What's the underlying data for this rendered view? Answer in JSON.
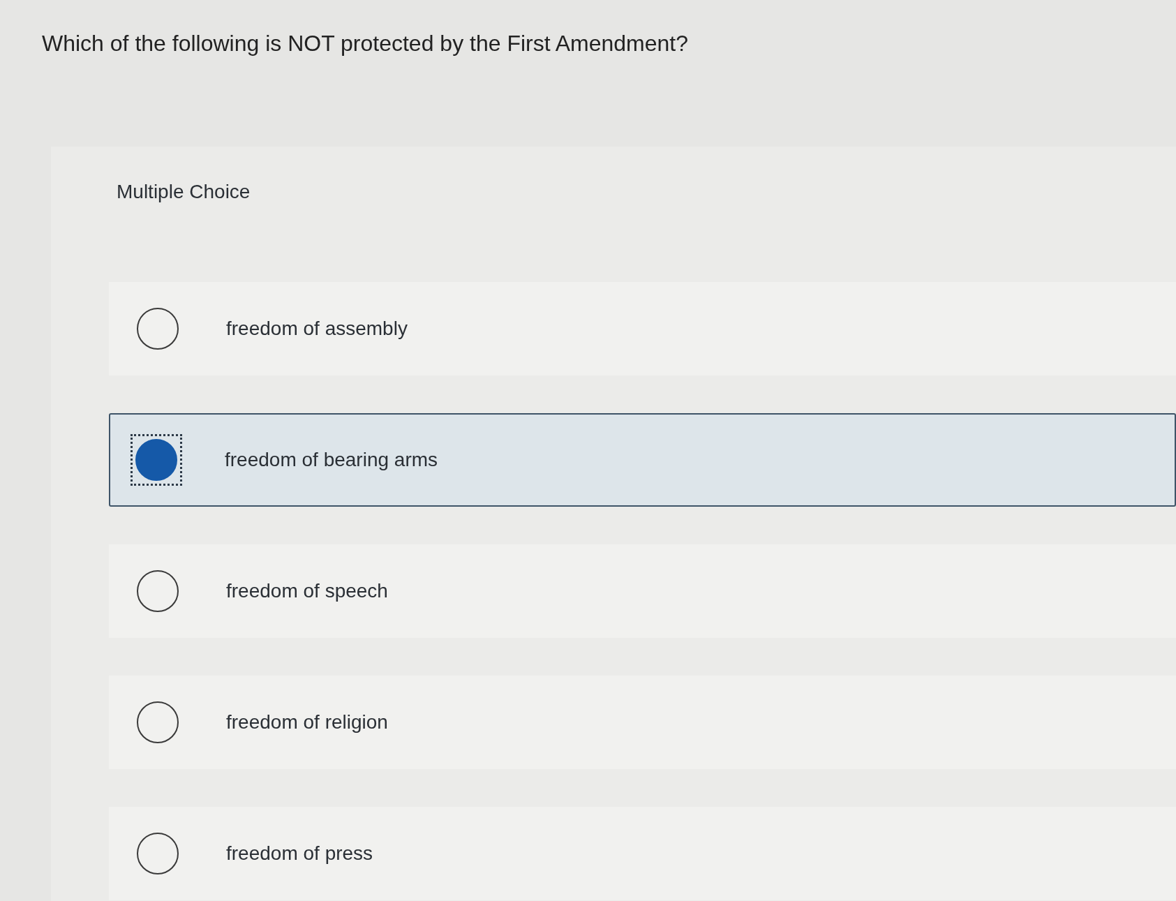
{
  "question": {
    "text": "Which of the following is NOT protected by the First Amendment?"
  },
  "section": {
    "label": "Multiple Choice"
  },
  "options": [
    {
      "label": "freedom of assembly",
      "selected": false,
      "focused": false
    },
    {
      "label": "freedom of bearing arms",
      "selected": true,
      "focused": true
    },
    {
      "label": "freedom of speech",
      "selected": false,
      "focused": false
    },
    {
      "label": "freedom of religion",
      "selected": false,
      "focused": false
    },
    {
      "label": "freedom of press",
      "selected": false,
      "focused": false
    }
  ]
}
